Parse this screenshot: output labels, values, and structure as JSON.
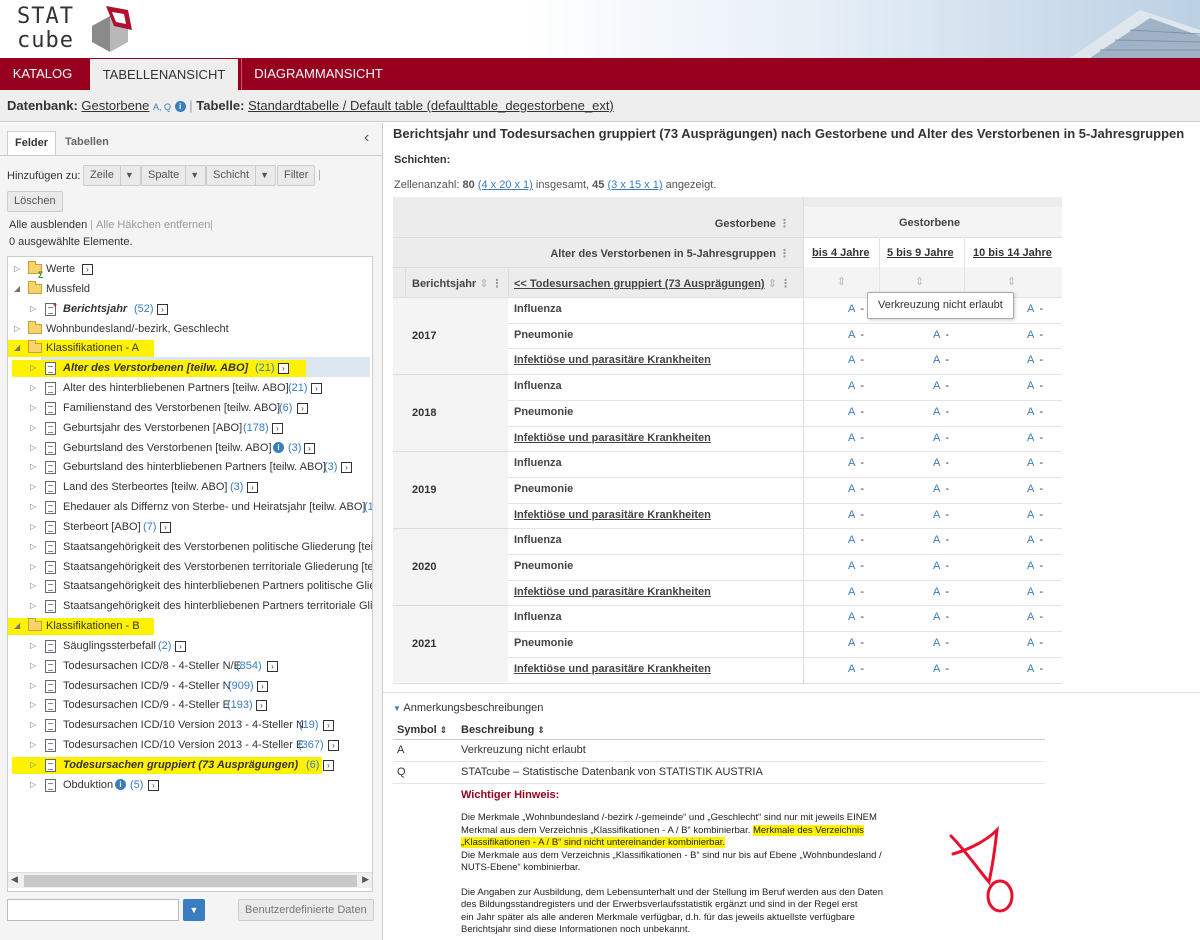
{
  "header": {
    "logo_line1": "STAT",
    "logo_line2": "cube"
  },
  "nav": {
    "tabs": [
      {
        "label": "KATALOG"
      },
      {
        "label": "TABELLENANSICHT"
      },
      {
        "label": "DIAGRAMMANSICHT"
      }
    ]
  },
  "dbbar": {
    "db_label": "Datenbank:",
    "db_name": "Gestorbene",
    "db_flags": "A, Q",
    "table_label": "Tabelle:",
    "table_name": "Standardtabelle / Default table (defaulttable_degestorbene_ext)"
  },
  "left": {
    "tabs": [
      "Felder",
      "Tabellen"
    ],
    "add_to": "Hinzufügen zu:",
    "buttons": {
      "zeile": "Zeile",
      "spalte": "Spalte",
      "schicht": "Schicht",
      "filter": "Filter",
      "loeschen": "Löschen"
    },
    "hide_all": "Alle ausblenden",
    "remove_checks": "Alle Häkchen entfernen",
    "selected_count": "0 ausgewählte Elemente.",
    "custom_data": "Benutzerdefinierte Daten",
    "tree": [
      {
        "label": "Werte",
        "count": ""
      },
      {
        "label": "Mussfeld",
        "count": ""
      },
      {
        "label": "Berichtsjahr",
        "count": "(52)"
      },
      {
        "label": "Wohnbundesland/-bezirk, Geschlecht",
        "count": ""
      },
      {
        "label": "Klassifikationen - A",
        "count": ""
      },
      {
        "label": "Alter des Verstorbenen [teilw. ABO]",
        "count": "(21)"
      },
      {
        "label": "Alter des hinterbliebenen Partners [teilw. ABO]",
        "count": "(21)"
      },
      {
        "label": "Familienstand des Verstorbenen [teilw. ABO]",
        "count": "(6)"
      },
      {
        "label": "Geburtsjahr des Verstorbenen [ABO]",
        "count": "(178)"
      },
      {
        "label": "Geburtsland des Verstorbenen [teilw. ABO]",
        "count": "(3)"
      },
      {
        "label": "Geburtsland des hinterbliebenen Partners [teilw. ABO]",
        "count": "(3)"
      },
      {
        "label": "Land des Sterbeortes [teilw. ABO]",
        "count": "(3)"
      },
      {
        "label": "Ehedauer als Differnz von Sterbe- und Heiratsjahr [teilw. ABO]",
        "count": "(1"
      },
      {
        "label": "Sterbeort [ABO]",
        "count": "(7)"
      },
      {
        "label": "Staatsangehörigkeit des Verstorbenen politische Gliederung [teilw",
        "count": ""
      },
      {
        "label": "Staatsangehörigkeit des Verstorbenen territoriale Gliederung [teilw",
        "count": ""
      },
      {
        "label": "Staatsangehörigkeit des hinterbliebenen Partners politische Glied",
        "count": ""
      },
      {
        "label": "Staatsangehörigkeit des hinterbliebenen Partners territoriale Glied",
        "count": ""
      },
      {
        "label": "Klassifikationen - B",
        "count": ""
      },
      {
        "label": "Säuglingssterbefall",
        "count": "(2)"
      },
      {
        "label": "Todesursachen ICD/8 - 4-Steller N/E",
        "count": "(854)"
      },
      {
        "label": "Todesursachen ICD/9 - 4-Steller N",
        "count": "(909)"
      },
      {
        "label": "Todesursachen ICD/9 - 4-Steller E",
        "count": "(193)"
      },
      {
        "label": "Todesursachen ICD/10 Version 2013 - 4-Steller N",
        "count": "(19)"
      },
      {
        "label": "Todesursachen ICD/10 Version 2013 - 4-Steller E",
        "count": "(367)"
      },
      {
        "label": "Todesursachen gruppiert (73 Ausprägungen)",
        "count": "(6)"
      },
      {
        "label": "Obduktion",
        "count": "(5)"
      }
    ]
  },
  "right": {
    "title": "Berichtsjahr und Todesursachen gruppiert (73 Ausprägungen) nach Gestorbene und Alter des Verstorbenen in 5-Jahresgruppen",
    "schichten": "Schichten:",
    "zell_prefix": "Zellenanzahl:",
    "zell_total": "80",
    "zell_total_dims": "(4 x 20 x 1)",
    "zell_mid": "insgesamt,",
    "zell_shown": "45",
    "zell_shown_dims": "(3 x 15 x 1)",
    "zell_suffix": "angezeigt.",
    "table": {
      "h_gestorbene": "Gestorbene",
      "h_gestorbene_col": "Gestorbene",
      "h_alter": "Alter des Verstorbenen in 5-Jahresgruppen",
      "age_groups": [
        "bis 4 Jahre",
        "5 bis 9 Jahre",
        "10 bis 14 Jahre"
      ],
      "h_berichtsjahr": "Berichtsjahr",
      "h_todesursachen": "<< Todesursachen gruppiert (73 Ausprägungen)",
      "years": [
        "2017",
        "2018",
        "2019",
        "2020",
        "2021"
      ],
      "causes": [
        "Influenza",
        "Pneumonie",
        "Infektiöse und parasitäre Krankheiten"
      ],
      "cell_symbol": "A",
      "cell_value": "-",
      "tooltip": "Verkreuzung nicht erlaubt"
    },
    "annotations": {
      "title": "Anmerkungsbeschreibungen",
      "col_symbol": "Symbol",
      "col_desc": "Beschreibung",
      "rows": [
        {
          "symbol": "A",
          "desc": "Verkreuzung nicht erlaubt"
        },
        {
          "symbol": "Q",
          "desc": "STATcube – Statistische Datenbank von STATISTIK AUSTRIA"
        }
      ],
      "notice_title": "Wichtiger Hinweis:",
      "p1a": "Die Merkmale „Wohnbundesland /-bezirk /-gemeinde“ und „Geschlecht“ sind nur mit jeweils EINEM",
      "p1b": "Merkmal aus dem Verzeichnis „Klassifikationen - A / B“ kombinierbar.",
      "p1c": "Merkmale des Verzeichnis",
      "p1d": "„Klassifikationen - A / B“ sind nicht untereinander kombinierbar.",
      "p2a": "Die Merkmale aus dem Verzeichnis „Klassifikationen - B“ sind nur bis auf Ebene „Wohnbundesland /",
      "p2b": "NUTS-Ebene“ kombinierbar.",
      "p3a": "Die Angaben zur Ausbildung, dem Lebensunterhalt und der Stellung im Beruf werden aus den Daten",
      "p3b": "des Bildungsstandregisters und der Erwerbsverlaufsstatistik ergänzt und sind in der Regel erst",
      "p3c": "ein Jahr später als alle anderen Merkmale verfügbar, d.h. für das jeweils aktuellste verfügbare",
      "p3d": "Berichtsjahr sind diese Informationen noch unbekannt."
    }
  }
}
